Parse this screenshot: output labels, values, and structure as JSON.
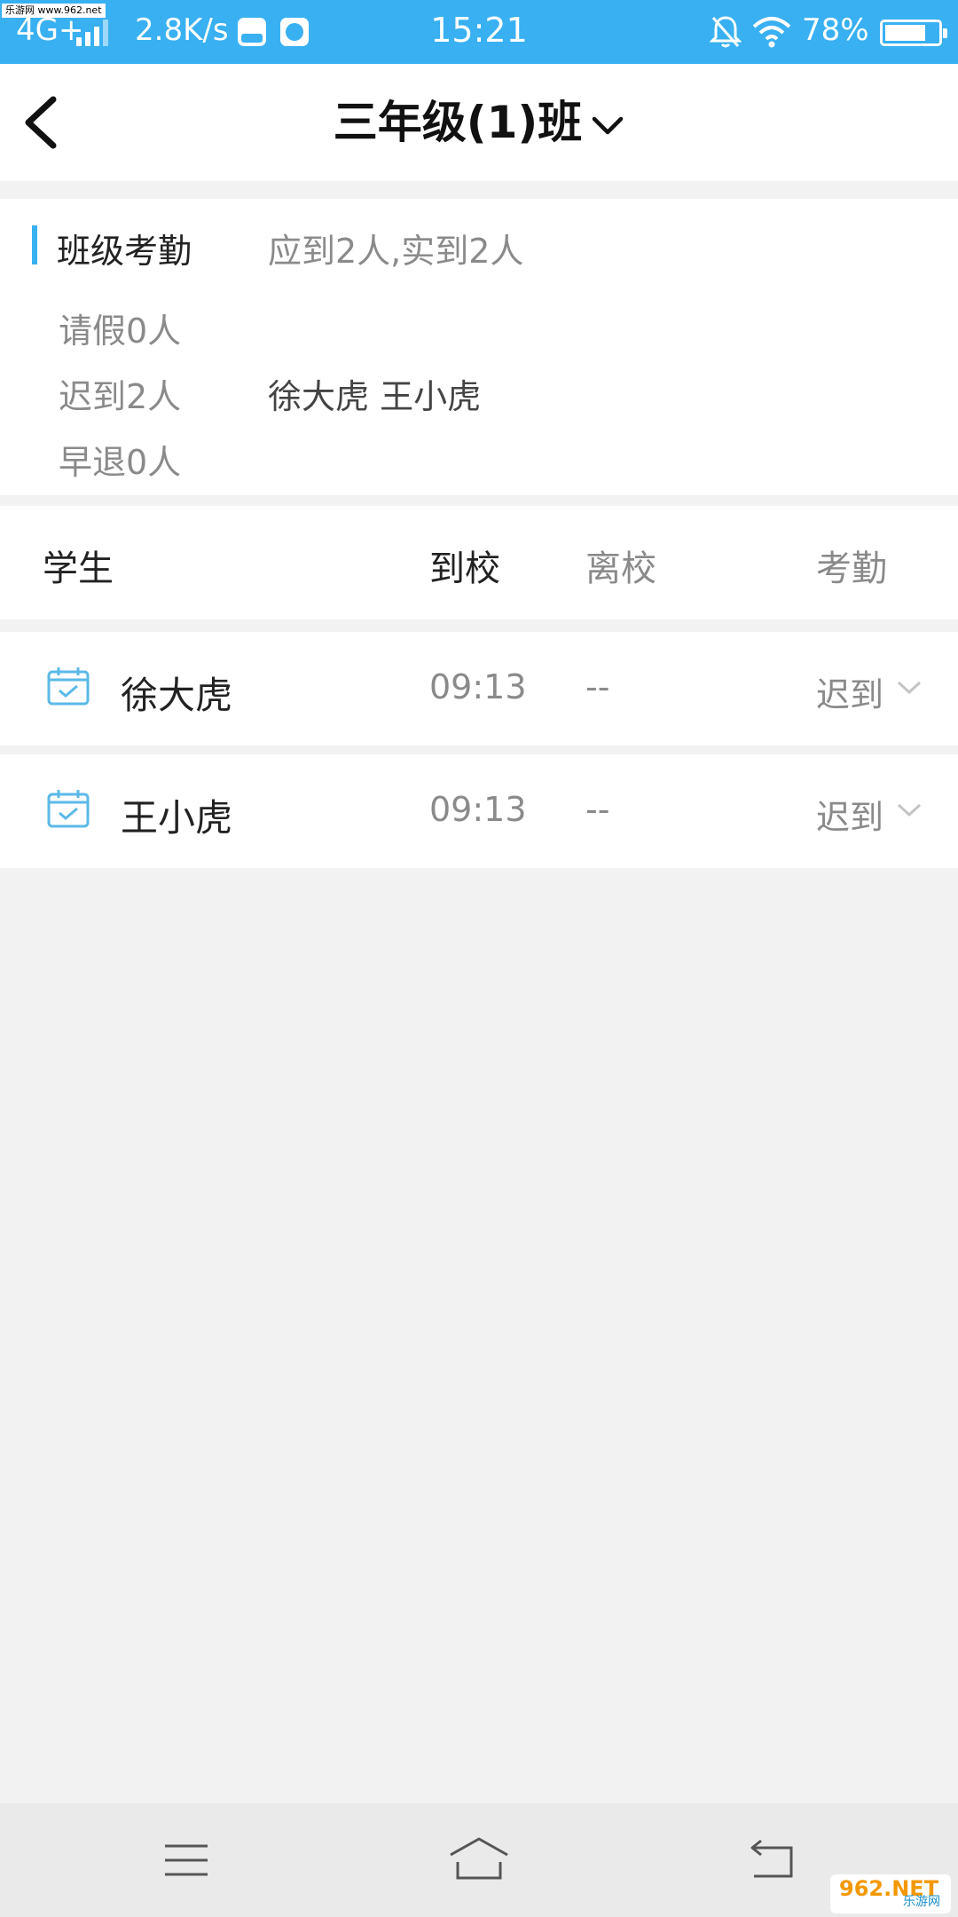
{
  "status_bar": {
    "watermark": "乐游网 www.962.net",
    "network": "4G+",
    "speed": "2.8K/s",
    "time": "15:21",
    "battery_percent": "78%",
    "battery_level": 0.78,
    "color": "#38b0f2"
  },
  "nav": {
    "back_icon": "chevron-left",
    "title": "三年级(1)班",
    "dropdown_icon": "chevron-down"
  },
  "summary": {
    "title": "班级考勤",
    "total": "应到2人,实到2人",
    "leave": "请假0人",
    "late": "迟到2人",
    "late_names": "徐大虎 王小虎",
    "early_leave": "早退0人",
    "accent_color": "#38b0f2"
  },
  "table": {
    "headers": {
      "student": "学生",
      "arrive": "到校",
      "leave": "离校",
      "attendance": "考勤"
    },
    "rows": [
      {
        "name": "徐大虎",
        "arrive": "09:13",
        "leave": "--",
        "status": "迟到",
        "icon": "calendar-check"
      },
      {
        "name": "王小虎",
        "arrive": "09:13",
        "leave": "--",
        "status": "迟到",
        "icon": "calendar-check"
      }
    ]
  },
  "system_nav": {
    "menu_icon": "menu",
    "home_icon": "home",
    "back_icon": "return",
    "logo_text": "962.NET",
    "logo_sub": "乐游网"
  }
}
